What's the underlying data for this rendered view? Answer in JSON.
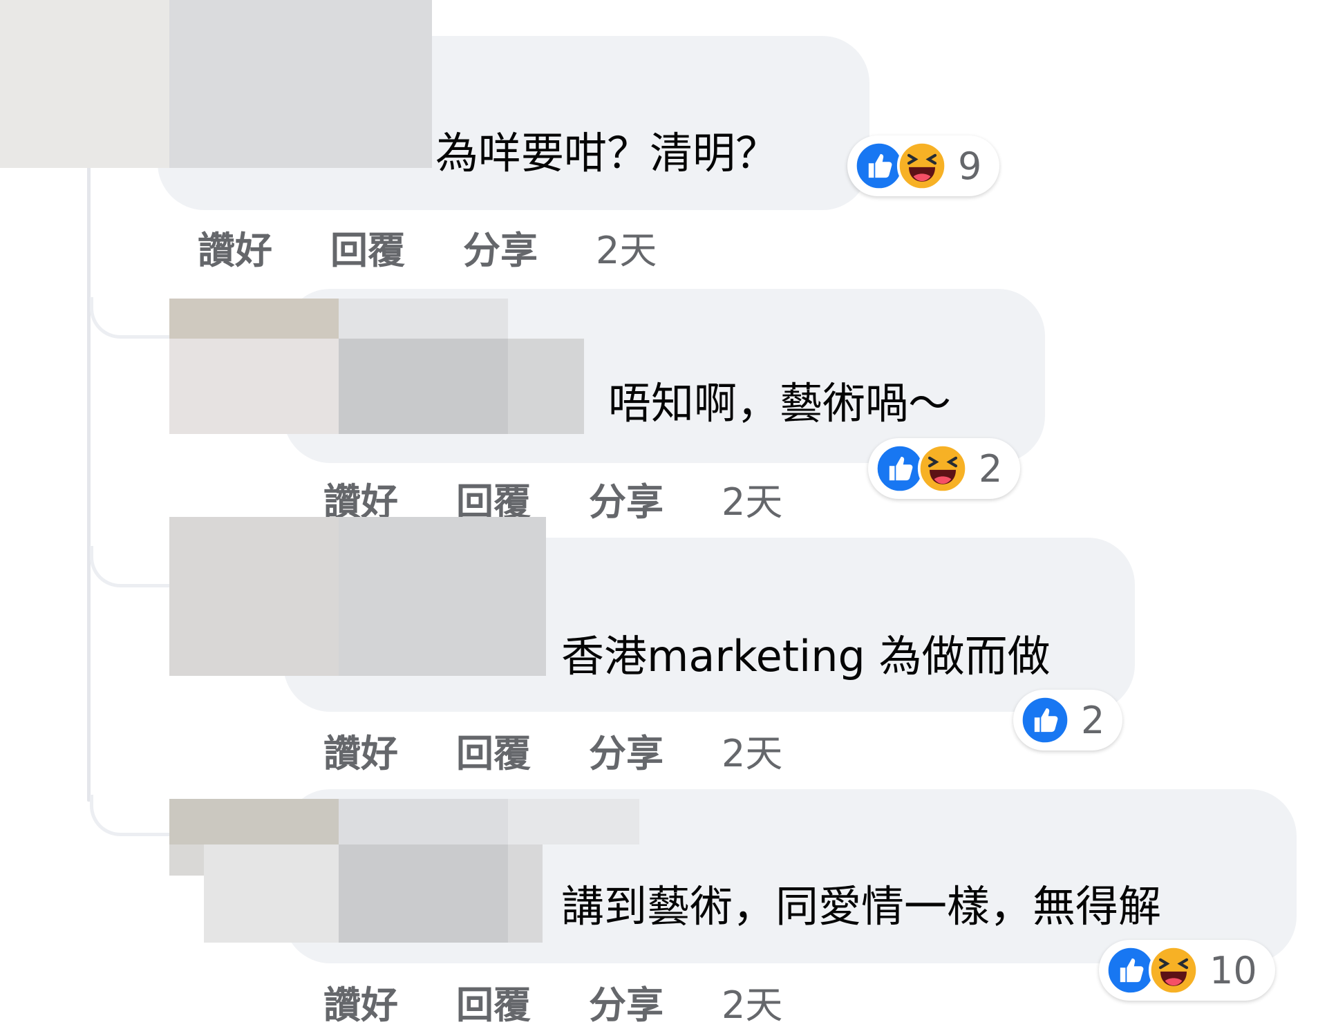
{
  "comments": [
    {
      "text": "為咩要咁？清明？",
      "reactions": {
        "icons": [
          "like-icon",
          "haha-icon"
        ],
        "count": "9"
      },
      "actions": {
        "like": "讚好",
        "reply": "回覆",
        "share": "分享",
        "time": "2天"
      }
    },
    {
      "text": "唔知啊，藝術喎～",
      "reactions": {
        "icons": [
          "like-icon",
          "haha-icon"
        ],
        "count": "2"
      },
      "actions": {
        "like": "讚好",
        "reply": "回覆",
        "share": "分享",
        "time": "2天"
      }
    },
    {
      "text": "香港marketing 為做而做",
      "reactions": {
        "icons": [
          "like-icon"
        ],
        "count": "2"
      },
      "actions": {
        "like": "讚好",
        "reply": "回覆",
        "share": "分享",
        "time": "2天"
      }
    },
    {
      "text": "講到藝術，同愛情一樣，無得解",
      "reactions": {
        "icons": [
          "like-icon",
          "haha-icon"
        ],
        "count": "10"
      },
      "actions": {
        "like": "讚好",
        "reply": "回覆",
        "share": "分享",
        "time": "2天"
      }
    }
  ],
  "colors": {
    "like_blue": "#1877f2",
    "haha_yellow": "#f7b125",
    "bubble": "#f0f2f5",
    "meta_text": "#65676b"
  }
}
